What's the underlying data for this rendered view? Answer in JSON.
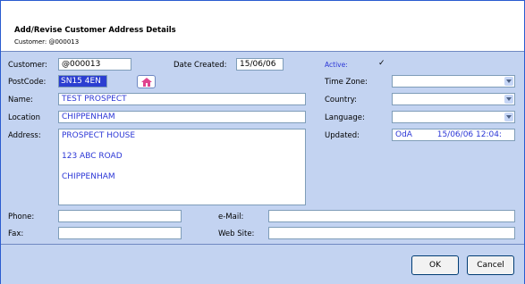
{
  "header": {
    "title": "Add/Revise Customer Address Details",
    "subtitle": "Customer: @000013"
  },
  "labels": {
    "customer": "Customer:",
    "date_created": "Date Created:",
    "active": "Active:",
    "postcode": "PostCode:",
    "time_zone": "Time Zone:",
    "name": "Name:",
    "country": "Country:",
    "location": "Location",
    "language": "Language:",
    "address": "Address:",
    "updated": "Updated:",
    "phone": "Phone:",
    "email": "e-Mail:",
    "fax": "Fax:",
    "website": "Web Site:"
  },
  "values": {
    "customer": "@000013",
    "date_created": "15/06/06",
    "active_checked": "✓",
    "postcode": "SN15 4EN",
    "name": "TEST PROSPECT",
    "location": "CHIPPENHAM",
    "address_lines": [
      "PROSPECT HOUSE",
      "123 ABC ROAD",
      "CHIPPENHAM"
    ],
    "updated_by": "OdA",
    "updated_time": "15/06/06 12:04:"
  },
  "buttons": {
    "ok": "OK",
    "cancel": "Cancel"
  },
  "icons": {
    "address_lookup": "house-icon"
  }
}
